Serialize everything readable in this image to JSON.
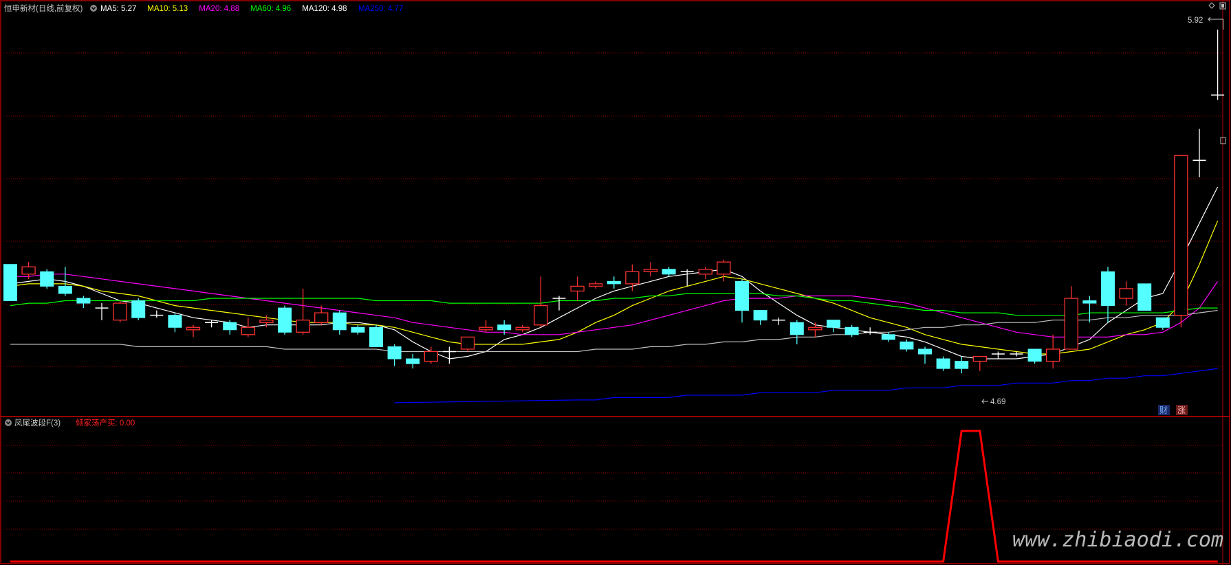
{
  "header": {
    "main_title": "恒申新材(日线,前复权)",
    "ma_items": [
      {
        "label": "MA5: 5.27",
        "color": "#ffffff"
      },
      {
        "label": "MA10: 5.13",
        "color": "#ffff00"
      },
      {
        "label": "MA20: 4.88",
        "color": "#ff00ff"
      },
      {
        "label": "MA60: 4.96",
        "color": "#00ff00"
      },
      {
        "label": "MA120: 4.98",
        "color": "#ffffff"
      },
      {
        "label": "MA250: 4.77",
        "color": "#0000ff"
      }
    ],
    "sub_title": "凤尾波段F(3)",
    "sub_value": "倾家荡产买: 0.00"
  },
  "badges": {
    "cai": "财",
    "zhang": "涨"
  },
  "annotations": {
    "high": "5.92",
    "low": "4.69"
  },
  "watermark": "www.zhibiaodi.com",
  "colors": {
    "up": "#ff3232",
    "down": "#54ffff",
    "grid": "#8b0000",
    "ma5": "#ffffff",
    "ma10": "#ffff00",
    "ma20": "#ff00ff",
    "ma60": "#00ff00",
    "ma120": "#c0c0c0",
    "ma250": "#0000ff",
    "indicator": "#ff0000"
  },
  "chart_data": {
    "type": "candlestick",
    "candles": [
      [
        4.95,
        4.8,
        4.95,
        4.8
      ],
      [
        4.91,
        4.94,
        4.96,
        4.89
      ],
      [
        4.92,
        4.86,
        4.93,
        4.85
      ],
      [
        4.86,
        4.83,
        4.94,
        4.82
      ],
      [
        4.81,
        4.79,
        4.82,
        4.77
      ],
      [
        4.77,
        4.77,
        4.79,
        4.72
      ],
      [
        4.72,
        4.79,
        4.8,
        4.71
      ],
      [
        4.8,
        4.73,
        4.81,
        4.72
      ],
      [
        4.74,
        4.74,
        4.76,
        4.73
      ],
      [
        4.74,
        4.69,
        4.75,
        4.67
      ],
      [
        4.68,
        4.69,
        4.7,
        4.65
      ],
      [
        4.71,
        4.71,
        4.72,
        4.69
      ],
      [
        4.71,
        4.68,
        4.72,
        4.66
      ],
      [
        4.66,
        4.69,
        4.73,
        4.65
      ],
      [
        4.71,
        4.72,
        4.74,
        4.69
      ],
      [
        4.77,
        4.67,
        4.78,
        4.66
      ],
      [
        4.67,
        4.72,
        4.85,
        4.66
      ],
      [
        4.71,
        4.75,
        4.78,
        4.7
      ],
      [
        4.75,
        4.68,
        4.76,
        4.66
      ],
      [
        4.69,
        4.67,
        4.7,
        4.66
      ],
      [
        4.69,
        4.61,
        4.7,
        4.61
      ],
      [
        4.61,
        4.56,
        4.62,
        4.53
      ],
      [
        4.56,
        4.54,
        4.58,
        4.52
      ],
      [
        4.55,
        4.59,
        4.61,
        4.54
      ],
      [
        4.59,
        4.59,
        4.61,
        4.54
      ],
      [
        4.6,
        4.65,
        4.65,
        4.59
      ],
      [
        4.68,
        4.69,
        4.72,
        4.67
      ],
      [
        4.7,
        4.68,
        4.72,
        4.66
      ],
      [
        4.68,
        4.69,
        4.7,
        4.67
      ],
      [
        4.7,
        4.78,
        4.9,
        4.69
      ],
      [
        4.81,
        4.81,
        4.82,
        4.76
      ],
      [
        4.84,
        4.86,
        4.9,
        4.8
      ],
      [
        4.86,
        4.87,
        4.88,
        4.85
      ],
      [
        4.88,
        4.87,
        4.9,
        4.85
      ],
      [
        4.87,
        4.92,
        4.95,
        4.84
      ],
      [
        4.92,
        4.93,
        4.96,
        4.9
      ],
      [
        4.93,
        4.91,
        4.94,
        4.9
      ],
      [
        4.92,
        4.92,
        4.93,
        4.86
      ],
      [
        4.91,
        4.93,
        4.94,
        4.89
      ],
      [
        4.91,
        4.96,
        4.97,
        4.88
      ],
      [
        4.88,
        4.76,
        4.89,
        4.71
      ],
      [
        4.76,
        4.72,
        4.76,
        4.7
      ],
      [
        4.72,
        4.72,
        4.73,
        4.7
      ],
      [
        4.71,
        4.66,
        4.72,
        4.62
      ],
      [
        4.68,
        4.69,
        4.71,
        4.65
      ],
      [
        4.72,
        4.69,
        4.72,
        4.67
      ],
      [
        4.69,
        4.66,
        4.7,
        4.65
      ],
      [
        4.67,
        4.67,
        4.69,
        4.66
      ],
      [
        4.66,
        4.64,
        4.67,
        4.63
      ],
      [
        4.63,
        4.6,
        4.64,
        4.59
      ],
      [
        4.6,
        4.58,
        4.61,
        4.54
      ],
      [
        4.56,
        4.52,
        4.57,
        4.51
      ],
      [
        4.55,
        4.52,
        4.57,
        4.5
      ],
      [
        4.55,
        4.57,
        4.57,
        4.51
      ],
      [
        4.58,
        4.58,
        4.59,
        4.56
      ],
      [
        4.58,
        4.58,
        4.59,
        4.57
      ],
      [
        4.6,
        4.55,
        4.6,
        4.54
      ],
      [
        4.55,
        4.6,
        4.66,
        4.52
      ],
      [
        4.6,
        4.81,
        4.86,
        4.6
      ],
      [
        4.8,
        4.79,
        4.82,
        4.71
      ],
      [
        4.92,
        4.78,
        4.94,
        4.71
      ],
      [
        4.81,
        4.85,
        4.88,
        4.78
      ],
      [
        4.87,
        4.76,
        4.87,
        4.76
      ],
      [
        4.73,
        4.69,
        4.73,
        4.68
      ],
      [
        4.74,
        5.4,
        5.4,
        4.69
      ],
      [
        5.38,
        5.38,
        5.51,
        5.31
      ],
      [
        5.65,
        5.65,
        5.92,
        5.63
      ]
    ],
    "ma": {
      "ma5": [
        4.87,
        4.88,
        4.89,
        4.88,
        4.86,
        4.83,
        4.8,
        4.79,
        4.77,
        4.75,
        4.73,
        4.72,
        4.71,
        4.69,
        4.7,
        4.7,
        4.7,
        4.7,
        4.71,
        4.71,
        4.7,
        4.68,
        4.63,
        4.59,
        4.56,
        4.57,
        4.59,
        4.64,
        4.66,
        4.69,
        4.73,
        4.77,
        4.81,
        4.84,
        4.86,
        4.88,
        4.9,
        4.91,
        4.92,
        4.93,
        4.9,
        4.84,
        4.79,
        4.74,
        4.7,
        4.69,
        4.68,
        4.67,
        4.66,
        4.65,
        4.63,
        4.6,
        4.57,
        4.56,
        4.56,
        4.56,
        4.57,
        4.58,
        4.61,
        4.64,
        4.71,
        4.76,
        4.81,
        4.83,
        4.97,
        5.12,
        5.27
      ],
      "ma10": [
        4.86,
        4.87,
        4.87,
        4.87,
        4.86,
        4.84,
        4.83,
        4.82,
        4.8,
        4.78,
        4.77,
        4.76,
        4.75,
        4.74,
        4.73,
        4.72,
        4.71,
        4.71,
        4.71,
        4.7,
        4.7,
        4.69,
        4.67,
        4.65,
        4.63,
        4.62,
        4.62,
        4.62,
        4.62,
        4.63,
        4.64,
        4.67,
        4.71,
        4.74,
        4.78,
        4.81,
        4.84,
        4.86,
        4.88,
        4.9,
        4.89,
        4.87,
        4.85,
        4.83,
        4.81,
        4.79,
        4.76,
        4.73,
        4.71,
        4.69,
        4.66,
        4.64,
        4.62,
        4.61,
        4.6,
        4.59,
        4.58,
        4.58,
        4.59,
        4.6,
        4.63,
        4.66,
        4.68,
        4.71,
        4.79,
        4.95,
        5.13
      ],
      "ma20": [
        4.9,
        4.9,
        4.91,
        4.91,
        4.9,
        4.89,
        4.88,
        4.87,
        4.86,
        4.85,
        4.84,
        4.83,
        4.82,
        4.81,
        4.8,
        4.79,
        4.78,
        4.77,
        4.76,
        4.75,
        4.74,
        4.73,
        4.71,
        4.7,
        4.69,
        4.68,
        4.67,
        4.67,
        4.66,
        4.66,
        4.66,
        4.67,
        4.68,
        4.69,
        4.7,
        4.72,
        4.74,
        4.76,
        4.78,
        4.8,
        4.81,
        4.81,
        4.81,
        4.82,
        4.82,
        4.82,
        4.82,
        4.81,
        4.8,
        4.79,
        4.77,
        4.75,
        4.73,
        4.71,
        4.69,
        4.67,
        4.66,
        4.65,
        4.65,
        4.65,
        4.65,
        4.66,
        4.66,
        4.67,
        4.71,
        4.77,
        4.88
      ],
      "ma60": [
        4.78,
        4.79,
        4.79,
        4.8,
        4.8,
        4.8,
        4.8,
        4.8,
        4.8,
        4.8,
        4.8,
        4.81,
        4.81,
        4.81,
        4.81,
        4.81,
        4.81,
        4.81,
        4.81,
        4.81,
        4.8,
        4.8,
        4.8,
        4.8,
        4.79,
        4.79,
        4.79,
        4.79,
        4.79,
        4.79,
        4.8,
        4.8,
        4.8,
        4.81,
        4.81,
        4.82,
        4.82,
        4.83,
        4.83,
        4.83,
        4.83,
        4.83,
        4.82,
        4.82,
        4.81,
        4.8,
        4.8,
        4.79,
        4.78,
        4.77,
        4.76,
        4.76,
        4.75,
        4.75,
        4.75,
        4.74,
        4.74,
        4.74,
        4.74,
        4.75,
        4.75,
        4.75,
        4.75,
        4.75,
        4.76,
        4.77,
        4.77
      ],
      "ma120": [
        4.62,
        4.62,
        4.62,
        4.62,
        4.62,
        4.62,
        4.62,
        4.61,
        4.61,
        4.61,
        4.61,
        4.61,
        4.61,
        4.61,
        4.61,
        4.6,
        4.6,
        4.6,
        4.6,
        4.6,
        4.6,
        4.59,
        4.59,
        4.59,
        4.59,
        4.59,
        4.59,
        4.59,
        4.59,
        4.59,
        4.59,
        4.59,
        4.6,
        4.6,
        4.6,
        4.61,
        4.61,
        4.62,
        4.62,
        4.63,
        4.63,
        4.64,
        4.64,
        4.65,
        4.65,
        4.66,
        4.66,
        4.67,
        4.67,
        4.68,
        4.69,
        4.69,
        4.7,
        4.7,
        4.71,
        4.71,
        4.71,
        4.72,
        4.72,
        4.72,
        4.73,
        4.73,
        4.74,
        4.74,
        4.74,
        4.75,
        4.76
      ],
      "ma250": [
        null,
        null,
        null,
        null,
        null,
        null,
        null,
        null,
        null,
        null,
        null,
        null,
        null,
        null,
        null,
        null,
        null,
        null,
        null,
        null,
        null,
        null,
        null,
        null,
        null,
        null,
        null,
        null,
        null,
        null,
        null,
        4.39,
        4.39,
        4.4,
        4.4,
        4.4,
        4.4,
        4.41,
        4.41,
        4.41,
        4.41,
        4.42,
        4.42,
        4.42,
        4.42,
        4.43,
        4.43,
        4.43,
        4.43,
        4.44,
        4.44,
        4.44,
        4.45,
        4.45,
        4.45,
        4.46,
        4.46,
        4.46,
        4.47,
        4.47,
        4.48,
        4.48,
        4.49,
        4.49,
        4.5,
        4.51,
        4.52
      ]
    },
    "indicator": {
      "name": "凤尾波段F(3)",
      "values": [
        0,
        0,
        0,
        0,
        0,
        0,
        0,
        0,
        0,
        0,
        0,
        0,
        0,
        0,
        0,
        0,
        0,
        0,
        0,
        0,
        0,
        0,
        0,
        0,
        0,
        0,
        0,
        0,
        0,
        0,
        0,
        0,
        0,
        0,
        0,
        0,
        0,
        0,
        0,
        0,
        0,
        0,
        0,
        0,
        0,
        0,
        0,
        0,
        0,
        0,
        0,
        0,
        1,
        1,
        0,
        0,
        0,
        0,
        0,
        0,
        0,
        0,
        0,
        0,
        0,
        0,
        0
      ]
    },
    "ylim": [
      4.35,
      5.98
    ],
    "indicator_ylim": [
      0,
      1
    ]
  }
}
